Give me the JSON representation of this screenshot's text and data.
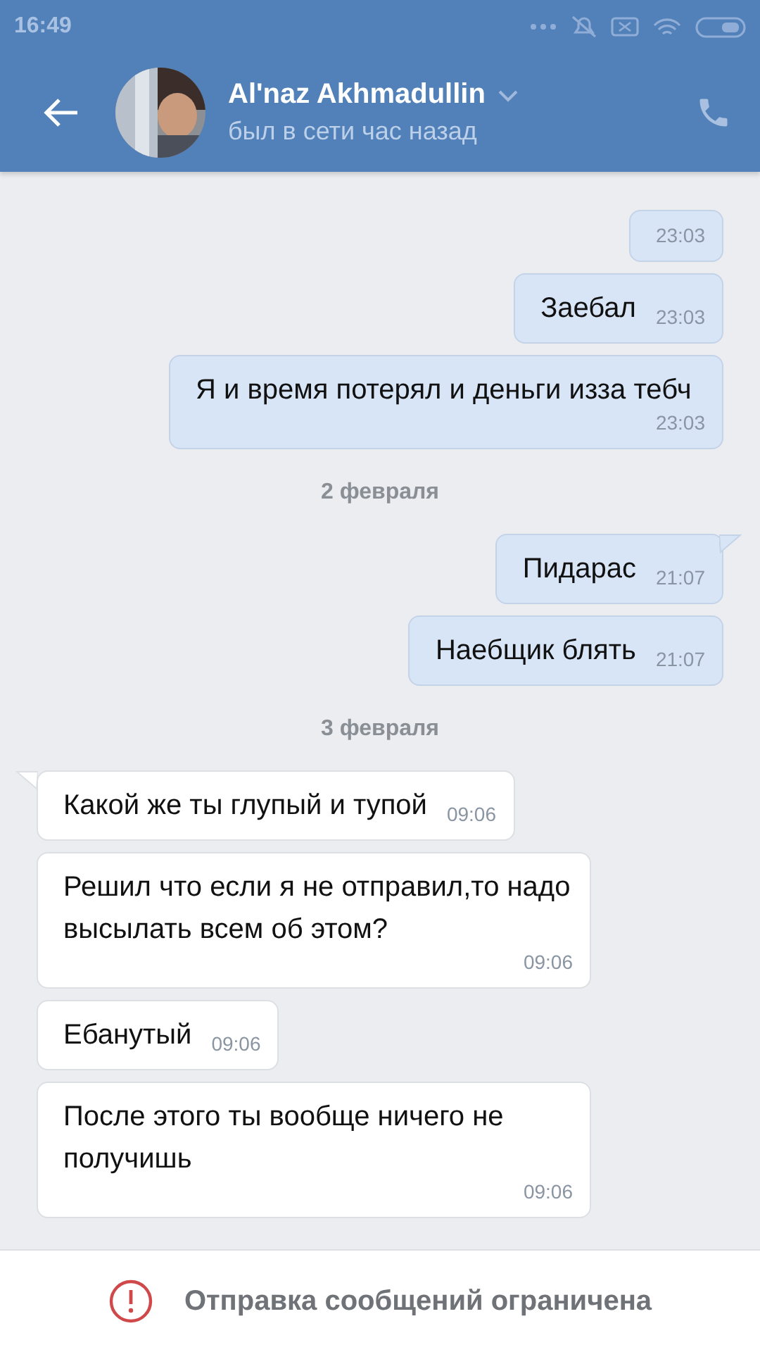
{
  "status_bar": {
    "time": "16:49"
  },
  "header": {
    "name": "Al'naz Akhmadullin",
    "status": "был в сети час назад"
  },
  "messages": [
    {
      "kind": "message",
      "outgoing": true,
      "tail": false,
      "time": "23:03"
    },
    {
      "kind": "message",
      "outgoing": true,
      "tail": false,
      "text": "Заебал",
      "time": "23:03"
    },
    {
      "kind": "message",
      "outgoing": true,
      "tail": false,
      "text": "Я и время потерял и деньги изза тебч",
      "time": "23:03"
    },
    {
      "kind": "date",
      "text": "2 февраля"
    },
    {
      "kind": "message",
      "outgoing": true,
      "tail": true,
      "text": "Пидарас",
      "time": "21:07"
    },
    {
      "kind": "message",
      "outgoing": true,
      "tail": false,
      "text": "Наебщик блять",
      "time": "21:07"
    },
    {
      "kind": "date",
      "text": "3 февраля"
    },
    {
      "kind": "message",
      "outgoing": false,
      "tail": true,
      "text": "Какой же ты глупый и тупой",
      "time": "09:06"
    },
    {
      "kind": "message",
      "outgoing": false,
      "tail": false,
      "text": "Решил что если я не отправил,то надо высылать всем об этом?",
      "time": "09:06"
    },
    {
      "kind": "message",
      "outgoing": false,
      "tail": false,
      "text": "Ебанутый",
      "time": "09:06"
    },
    {
      "kind": "message",
      "outgoing": false,
      "tail": false,
      "text": "После этого ты вообще ничего не получишь",
      "time": "09:06"
    }
  ],
  "footer": {
    "notice": "Отправка сообщений ограничена"
  }
}
